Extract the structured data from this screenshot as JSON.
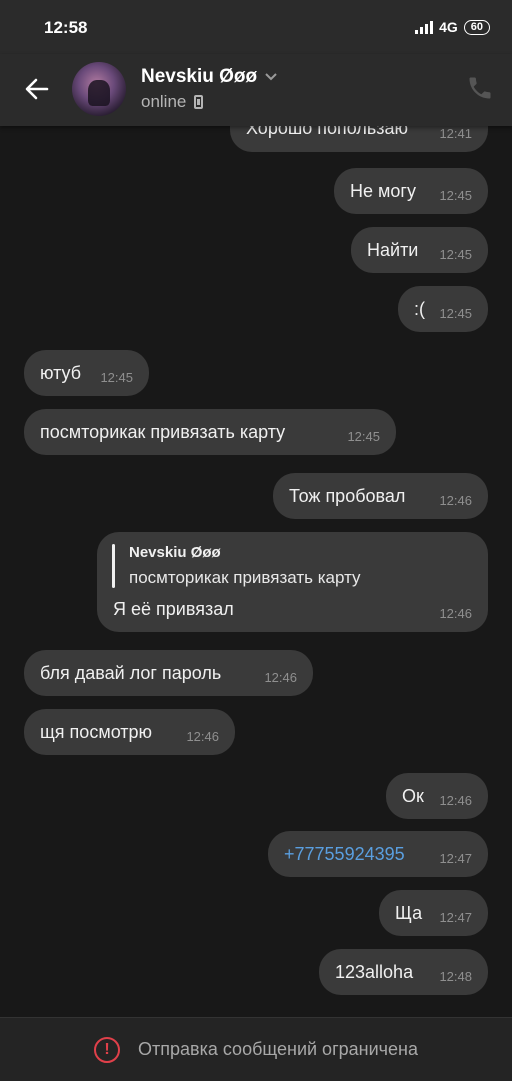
{
  "status_bar": {
    "time": "12:58",
    "network": "4G",
    "battery": "60"
  },
  "header": {
    "name": "Nevskiu Øøø",
    "status": "online"
  },
  "messages": [
    {
      "text": "Хорошо попользаю",
      "time": "12:41",
      "dir": "out"
    },
    {
      "text": "Не могу",
      "time": "12:45",
      "dir": "out"
    },
    {
      "text": "Найти",
      "time": "12:45",
      "dir": "out"
    },
    {
      "text": ":(",
      "time": "12:45",
      "dir": "out"
    },
    {
      "text": "ютуб",
      "time": "12:45",
      "dir": "in"
    },
    {
      "text": "посмторикак привязать карту",
      "time": "12:45",
      "dir": "in"
    },
    {
      "text": "Тож пробовал",
      "time": "12:46",
      "dir": "out"
    },
    {
      "reply_name": "Nevskiu Øøø",
      "reply_text": "посмторикак привязать карту",
      "text": "Я её привязал",
      "time": "12:46",
      "dir": "out"
    },
    {
      "text": "бля давай лог пароль",
      "time": "12:46",
      "dir": "in"
    },
    {
      "text": "щя посмотрю",
      "time": "12:46",
      "dir": "in"
    },
    {
      "text": "Ок",
      "time": "12:46",
      "dir": "out"
    },
    {
      "text": "+77755924395",
      "time": "12:47",
      "dir": "out"
    },
    {
      "text": "Ща",
      "time": "12:47",
      "dir": "out"
    },
    {
      "text": "123alloha",
      "time": "12:48",
      "dir": "out"
    }
  ],
  "footer": {
    "text": "Отправка сообщений ограничена",
    "icon": "!"
  }
}
